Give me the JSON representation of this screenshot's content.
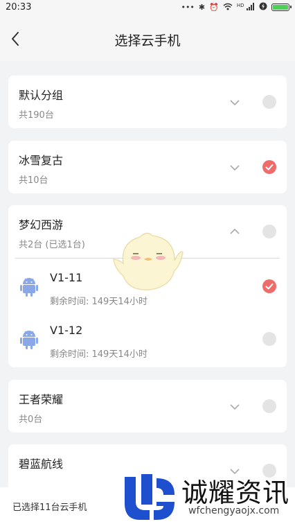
{
  "status_bar": {
    "time": "20:33",
    "icons": [
      "more-dots-icon",
      "bluetooth-icon",
      "alarm-icon",
      "wifi-icon",
      "signal-icon",
      "charging-icon",
      "battery-icon"
    ],
    "signal_label": "HD",
    "battery_color": "#4cd05a"
  },
  "header": {
    "title": "选择云手机",
    "back_icon": "back-arrow-icon"
  },
  "groups": [
    {
      "name": "默认分组",
      "count": "共190台",
      "expanded": false,
      "checked": false
    },
    {
      "name": "冰雪复古",
      "count": "共10台",
      "expanded": false,
      "checked": true
    },
    {
      "name": "梦幻西游",
      "count": "共2台 (已选1台)",
      "expanded": true,
      "checked": false,
      "devices": [
        {
          "name": "V1-11",
          "time": "剩余时间: 149天14小时",
          "checked": true
        },
        {
          "name": "V1-12",
          "time": "剩余时间: 149天14小时",
          "checked": false
        }
      ]
    },
    {
      "name": "王者荣耀",
      "count": "共0台",
      "expanded": false,
      "checked": false
    },
    {
      "name": "碧蓝航线",
      "count": "",
      "expanded": false,
      "checked": false
    }
  ],
  "footer": {
    "selected_text": "已选择11台云手机"
  },
  "watermark": {
    "brand": "诚耀资讯",
    "url": "wfchengyaojx.com"
  },
  "colors": {
    "accent_red": "#f06c6a",
    "android_blue": "#8aa8e8",
    "background": "#f2f3f5"
  }
}
